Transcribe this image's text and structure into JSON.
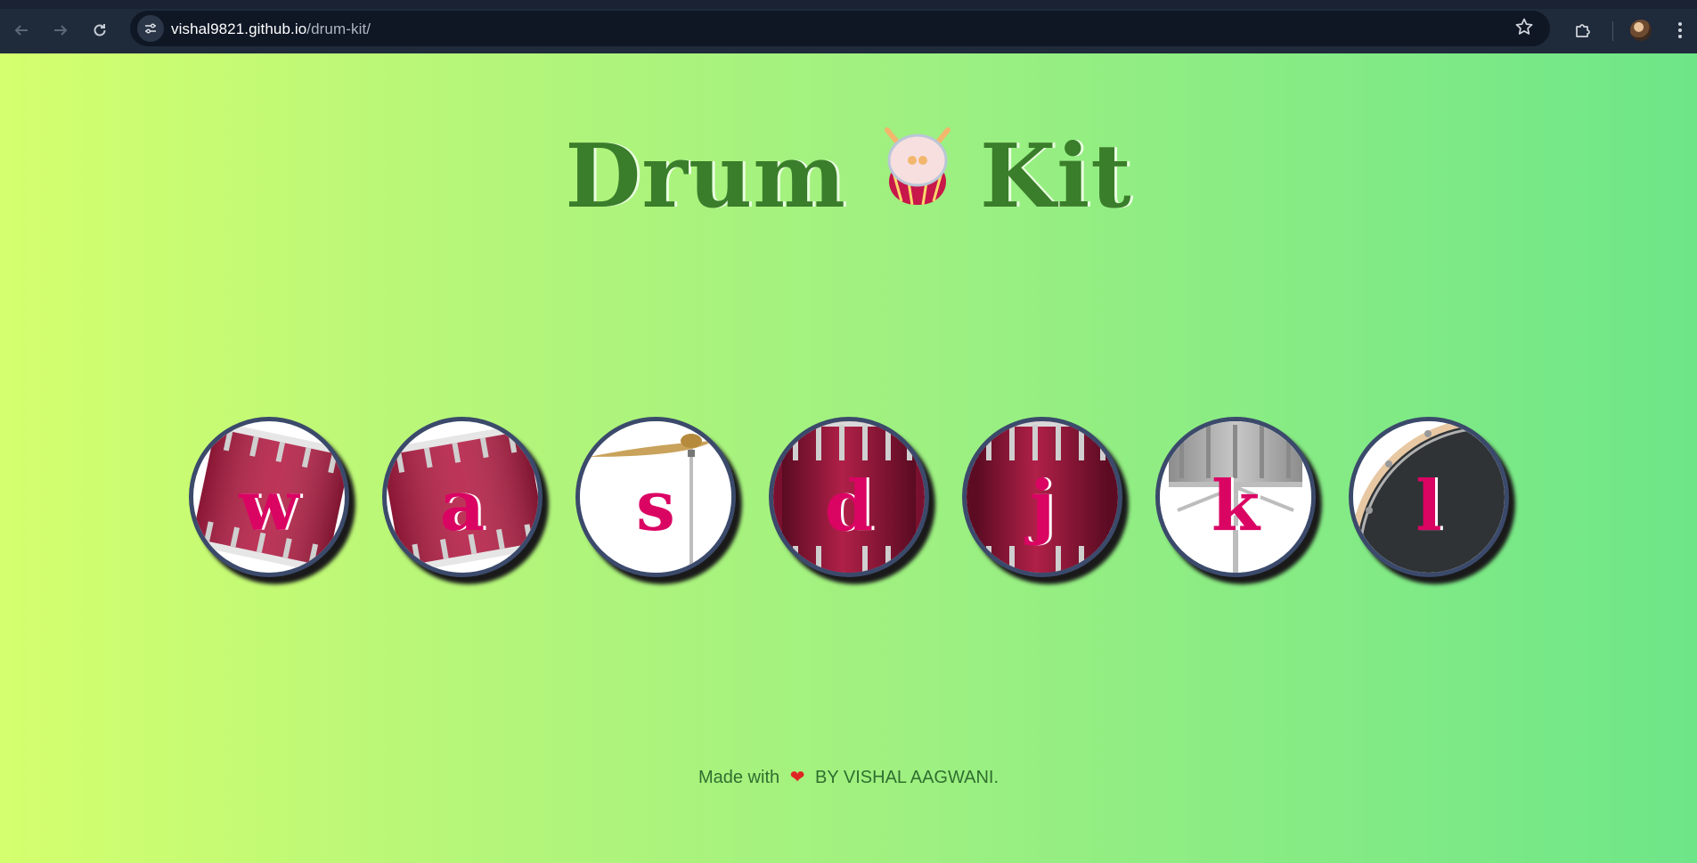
{
  "browser": {
    "url_host": "vishal9821.github.io",
    "url_path": "/drum-kit/",
    "icons": {
      "back": "back-arrow-icon",
      "forward": "forward-arrow-icon",
      "reload": "reload-icon",
      "site_info": "tune-icon",
      "bookmark": "star-icon",
      "extensions": "puzzle-icon",
      "profile": "avatar",
      "menu": "kebab-menu-icon"
    }
  },
  "page": {
    "title_left": "Drum",
    "title_right": "Kit",
    "drums": [
      {
        "key": "w",
        "art": "tom-1"
      },
      {
        "key": "a",
        "art": "tom-2"
      },
      {
        "key": "s",
        "art": "crash-cymbal"
      },
      {
        "key": "d",
        "art": "tom-3"
      },
      {
        "key": "j",
        "art": "tom-4"
      },
      {
        "key": "k",
        "art": "snare"
      },
      {
        "key": "l",
        "art": "kick"
      }
    ],
    "footer_prefix": "Made with",
    "footer_suffix": "BY VISHAL AAGWANI.",
    "colors": {
      "key_letter": "#da0463",
      "title": "#3a7d2a",
      "drum_border": "#3b4a6b",
      "footer_text": "#2f6f2f"
    }
  }
}
